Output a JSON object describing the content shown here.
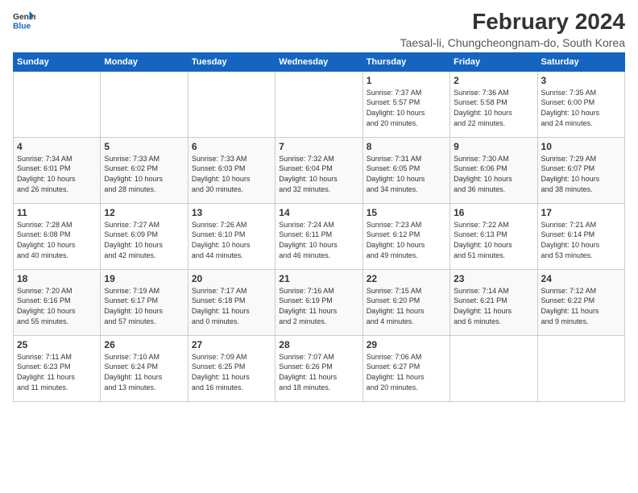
{
  "logo": {
    "line1": "General",
    "line2": "Blue"
  },
  "title": "February 2024",
  "subtitle": "Taesal-li, Chungcheongnam-do, South Korea",
  "days_header": [
    "Sunday",
    "Monday",
    "Tuesday",
    "Wednesday",
    "Thursday",
    "Friday",
    "Saturday"
  ],
  "weeks": [
    [
      {
        "day": "",
        "content": ""
      },
      {
        "day": "",
        "content": ""
      },
      {
        "day": "",
        "content": ""
      },
      {
        "day": "",
        "content": ""
      },
      {
        "day": "1",
        "content": "Sunrise: 7:37 AM\nSunset: 5:57 PM\nDaylight: 10 hours\nand 20 minutes."
      },
      {
        "day": "2",
        "content": "Sunrise: 7:36 AM\nSunset: 5:58 PM\nDaylight: 10 hours\nand 22 minutes."
      },
      {
        "day": "3",
        "content": "Sunrise: 7:35 AM\nSunset: 6:00 PM\nDaylight: 10 hours\nand 24 minutes."
      }
    ],
    [
      {
        "day": "4",
        "content": "Sunrise: 7:34 AM\nSunset: 6:01 PM\nDaylight: 10 hours\nand 26 minutes."
      },
      {
        "day": "5",
        "content": "Sunrise: 7:33 AM\nSunset: 6:02 PM\nDaylight: 10 hours\nand 28 minutes."
      },
      {
        "day": "6",
        "content": "Sunrise: 7:33 AM\nSunset: 6:03 PM\nDaylight: 10 hours\nand 30 minutes."
      },
      {
        "day": "7",
        "content": "Sunrise: 7:32 AM\nSunset: 6:04 PM\nDaylight: 10 hours\nand 32 minutes."
      },
      {
        "day": "8",
        "content": "Sunrise: 7:31 AM\nSunset: 6:05 PM\nDaylight: 10 hours\nand 34 minutes."
      },
      {
        "day": "9",
        "content": "Sunrise: 7:30 AM\nSunset: 6:06 PM\nDaylight: 10 hours\nand 36 minutes."
      },
      {
        "day": "10",
        "content": "Sunrise: 7:29 AM\nSunset: 6:07 PM\nDaylight: 10 hours\nand 38 minutes."
      }
    ],
    [
      {
        "day": "11",
        "content": "Sunrise: 7:28 AM\nSunset: 6:08 PM\nDaylight: 10 hours\nand 40 minutes."
      },
      {
        "day": "12",
        "content": "Sunrise: 7:27 AM\nSunset: 6:09 PM\nDaylight: 10 hours\nand 42 minutes."
      },
      {
        "day": "13",
        "content": "Sunrise: 7:26 AM\nSunset: 6:10 PM\nDaylight: 10 hours\nand 44 minutes."
      },
      {
        "day": "14",
        "content": "Sunrise: 7:24 AM\nSunset: 6:11 PM\nDaylight: 10 hours\nand 46 minutes."
      },
      {
        "day": "15",
        "content": "Sunrise: 7:23 AM\nSunset: 6:12 PM\nDaylight: 10 hours\nand 49 minutes."
      },
      {
        "day": "16",
        "content": "Sunrise: 7:22 AM\nSunset: 6:13 PM\nDaylight: 10 hours\nand 51 minutes."
      },
      {
        "day": "17",
        "content": "Sunrise: 7:21 AM\nSunset: 6:14 PM\nDaylight: 10 hours\nand 53 minutes."
      }
    ],
    [
      {
        "day": "18",
        "content": "Sunrise: 7:20 AM\nSunset: 6:16 PM\nDaylight: 10 hours\nand 55 minutes."
      },
      {
        "day": "19",
        "content": "Sunrise: 7:19 AM\nSunset: 6:17 PM\nDaylight: 10 hours\nand 57 minutes."
      },
      {
        "day": "20",
        "content": "Sunrise: 7:17 AM\nSunset: 6:18 PM\nDaylight: 11 hours\nand 0 minutes."
      },
      {
        "day": "21",
        "content": "Sunrise: 7:16 AM\nSunset: 6:19 PM\nDaylight: 11 hours\nand 2 minutes."
      },
      {
        "day": "22",
        "content": "Sunrise: 7:15 AM\nSunset: 6:20 PM\nDaylight: 11 hours\nand 4 minutes."
      },
      {
        "day": "23",
        "content": "Sunrise: 7:14 AM\nSunset: 6:21 PM\nDaylight: 11 hours\nand 6 minutes."
      },
      {
        "day": "24",
        "content": "Sunrise: 7:12 AM\nSunset: 6:22 PM\nDaylight: 11 hours\nand 9 minutes."
      }
    ],
    [
      {
        "day": "25",
        "content": "Sunrise: 7:11 AM\nSunset: 6:23 PM\nDaylight: 11 hours\nand 11 minutes."
      },
      {
        "day": "26",
        "content": "Sunrise: 7:10 AM\nSunset: 6:24 PM\nDaylight: 11 hours\nand 13 minutes."
      },
      {
        "day": "27",
        "content": "Sunrise: 7:09 AM\nSunset: 6:25 PM\nDaylight: 11 hours\nand 16 minutes."
      },
      {
        "day": "28",
        "content": "Sunrise: 7:07 AM\nSunset: 6:26 PM\nDaylight: 11 hours\nand 18 minutes."
      },
      {
        "day": "29",
        "content": "Sunrise: 7:06 AM\nSunset: 6:27 PM\nDaylight: 11 hours\nand 20 minutes."
      },
      {
        "day": "",
        "content": ""
      },
      {
        "day": "",
        "content": ""
      }
    ]
  ]
}
